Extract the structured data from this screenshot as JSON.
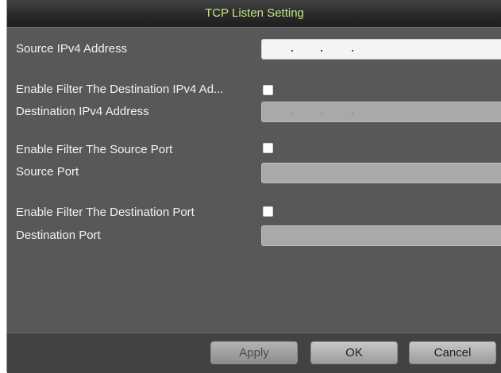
{
  "dialog": {
    "title": "TCP Listen Setting",
    "title_color": "#c6e67a"
  },
  "form": {
    "source_ipv4_label": "Source IPv4 Address",
    "source_ipv4_value": ". . .",
    "enable_dest_ipv4_label": "Enable Filter The Destination IPv4 Ad...",
    "enable_dest_ipv4_checked": false,
    "dest_ipv4_label": "Destination IPv4 Address",
    "dest_ipv4_value": ". . .",
    "enable_source_port_label": "Enable Filter The Source Port",
    "enable_source_port_checked": false,
    "source_port_label": "Source Port",
    "source_port_value": "",
    "enable_dest_port_label": "Enable Filter The Destination Port",
    "enable_dest_port_checked": false,
    "dest_port_label": "Destination Port",
    "dest_port_value": ""
  },
  "buttons": {
    "apply": "Apply",
    "ok": "OK",
    "cancel": "Cancel"
  }
}
